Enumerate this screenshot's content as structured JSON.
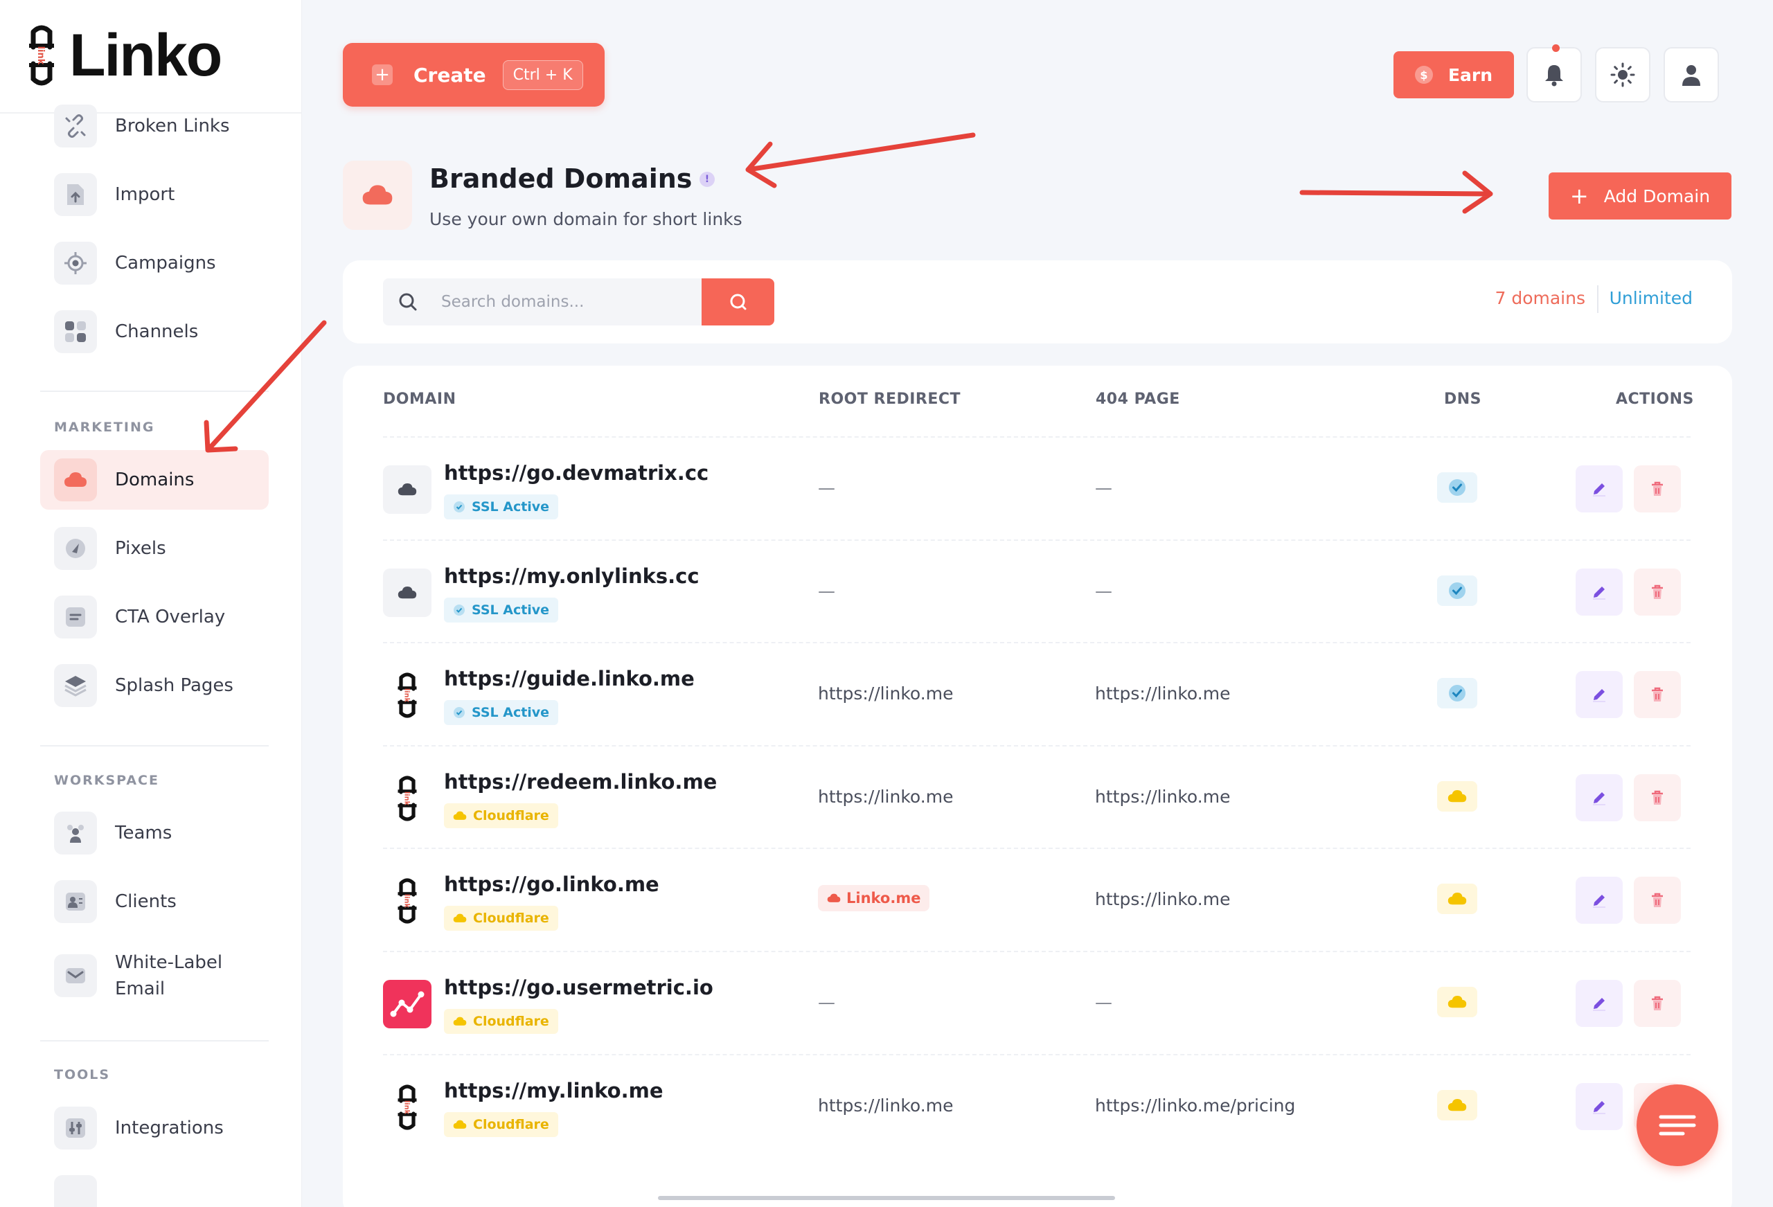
{
  "app": {
    "name": "Linko"
  },
  "sidebar": {
    "items_top": [
      {
        "label": "Broken Links",
        "icon": "broken-link-icon"
      },
      {
        "label": "Import",
        "icon": "import-icon"
      },
      {
        "label": "Campaigns",
        "icon": "target-icon"
      },
      {
        "label": "Channels",
        "icon": "grid-icon"
      }
    ],
    "marketing_label": "MARKETING",
    "marketing_items": [
      {
        "label": "Domains",
        "icon": "cloud-icon",
        "active": true
      },
      {
        "label": "Pixels",
        "icon": "pixel-icon"
      },
      {
        "label": "CTA Overlay",
        "icon": "overlay-icon"
      },
      {
        "label": "Splash Pages",
        "icon": "layers-icon"
      }
    ],
    "workspace_label": "WORKSPACE",
    "workspace_items": [
      {
        "label": "Teams",
        "icon": "teams-icon"
      },
      {
        "label": "Clients",
        "icon": "clients-icon"
      },
      {
        "label": "White-Label",
        "label2": "Email",
        "icon": "mail-icon"
      }
    ],
    "tools_label": "TOOLS",
    "tools_items": [
      {
        "label": "Integrations",
        "icon": "integrations-icon"
      }
    ]
  },
  "topbar": {
    "create_label": "Create",
    "create_shortcut": "Ctrl + K",
    "earn_label": "Earn"
  },
  "header": {
    "title": "Branded Domains",
    "subtitle": "Use your own domain for short links",
    "add_label": "Add Domain"
  },
  "search": {
    "placeholder": "Search domains...",
    "count": "7 domains",
    "plan": "Unlimited"
  },
  "table": {
    "headers": {
      "domain": "DOMAIN",
      "root": "ROOT REDIRECT",
      "notfound": "404 PAGE",
      "dns": "DNS",
      "actions": "ACTIONS"
    },
    "rows": [
      {
        "url": "https://go.devmatrix.cc",
        "badge": "SSL Active",
        "badge_type": "ssl",
        "icon": "cloud",
        "root": "—",
        "notfound": "—",
        "dns": "verified"
      },
      {
        "url": "https://my.onlylinks.cc",
        "badge": "SSL Active",
        "badge_type": "ssl",
        "icon": "cloud",
        "root": "—",
        "notfound": "—",
        "dns": "verified"
      },
      {
        "url": "https://guide.linko.me",
        "badge": "SSL Active",
        "badge_type": "ssl",
        "icon": "linko",
        "root": "https://linko.me",
        "notfound": "https://linko.me",
        "dns": "verified"
      },
      {
        "url": "https://redeem.linko.me",
        "badge": "Cloudflare",
        "badge_type": "cf",
        "icon": "linko",
        "root": "https://linko.me",
        "notfound": "https://linko.me",
        "dns": "cloudflare"
      },
      {
        "url": "https://go.linko.me",
        "badge": "Cloudflare",
        "badge_type": "cf",
        "icon": "linko",
        "root": "Linko.me",
        "root_pill": true,
        "notfound": "https://linko.me",
        "dns": "cloudflare"
      },
      {
        "url": "https://go.usermetric.io",
        "badge": "Cloudflare",
        "badge_type": "cf",
        "icon": "graph",
        "root": "—",
        "notfound": "—",
        "dns": "cloudflare"
      },
      {
        "url": "https://my.linko.me",
        "badge": "Cloudflare",
        "badge_type": "cf",
        "icon": "linko",
        "root": "https://linko.me",
        "notfound": "https://linko.me/pricing",
        "dns": "cloudflare"
      }
    ]
  },
  "colors": {
    "accent": "#f66657",
    "ssl": "#2496c9",
    "cloudflare": "#e9b400",
    "edit": "#7b4fe0",
    "delete": "#ef6b7c"
  }
}
